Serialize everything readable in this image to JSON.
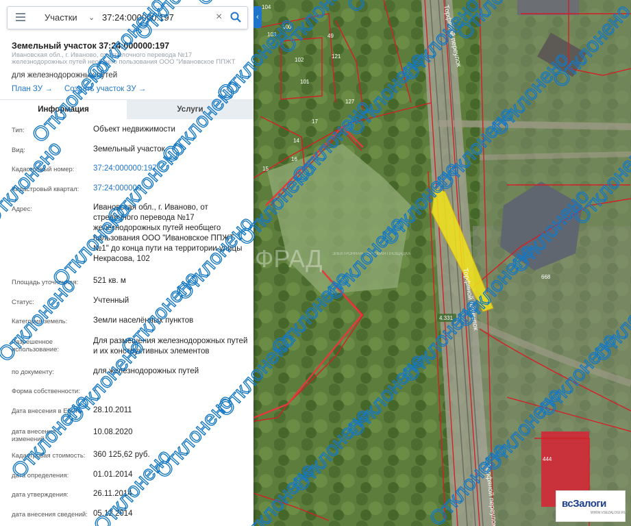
{
  "search": {
    "type_label": "Участки",
    "query": "37:24:000000:197"
  },
  "parcel": {
    "title": "Земельный участок 37:24:000000:197",
    "address_short": "Ивановская обл., г. Иваново, от стрелочного перевода №17 железнодорожных путей необщего пользования ООО \"Ивановское ППЖТ №1\" до конца пути н...",
    "use_short": "для железнодорожных путей",
    "link_plan": "План ЗУ →",
    "link_create": "Создать участок ЗУ →"
  },
  "tabs": [
    "Информация",
    "Услуги"
  ],
  "info_rows": [
    {
      "label": "Тип:",
      "value": "Объект недвижимости"
    },
    {
      "label": "Вид:",
      "value": "Земельный участок"
    },
    {
      "label": "Кадастровый номер:",
      "value": "37:24:000000:197"
    },
    {
      "label": "Кадастровый квартал:",
      "value": "37:24:000000"
    },
    {
      "label": "Адрес:",
      "value": "Ивановская обл., г. Иваново, от стрелочного перевода №17 железнодорожных путей необщего пользования ООО \"Ивановское ППЖТ №1\" до конца пути на территории улицы Некрасова, 102"
    },
    {
      "label": "Площадь уточненная:",
      "value": "521 кв. м"
    },
    {
      "label": "Статус:",
      "value": "Учтенный"
    },
    {
      "label": "Категория земель:",
      "value": "Земли населённых пунктов"
    },
    {
      "label": "Разрешенное использование:",
      "value": "Для размещения железнодорожных путей и их конструктивных элементов"
    },
    {
      "label": "по документу:",
      "value": "для железнодорожных путей"
    },
    {
      "label": "Форма собственности:",
      "value": "-"
    },
    {
      "label": "Дата внесения в ЕГРН:",
      "value": "28.10.2011"
    },
    {
      "label": "дата внесения изменений:",
      "value": "10.08.2020"
    },
    {
      "label": "Кадастровая стоимость:",
      "value": "360 125,62 руб."
    },
    {
      "label": "дата определения:",
      "value": "01.01.2014"
    },
    {
      "label": "дата утверждения:",
      "value": "26.11.2014"
    },
    {
      "label": "дата внесения сведений:",
      "value": "05.12.2014"
    }
  ],
  "map": {
    "street_1": "Торфяной переулок",
    "street_2": "Торфяной переулок",
    "street_3": "Торфяной переулок",
    "parcel_labels": [
      "104",
      "103",
      "102",
      "101",
      "127",
      "17",
      "14",
      "16",
      "15",
      "668",
      "444",
      "49",
      "100",
      "121"
    ],
    "marker": "4.331",
    "watermark_brand": "ФРАД",
    "watermark_sub": "ЭЛЕКТРОННАЯ ТОРГОВАЯ ПЛОЩАДКА"
  },
  "watermark": "Отклонено",
  "logo": {
    "text": "всЗалоги",
    "sub": "WWW.VSEZALOGI.RU"
  },
  "colors": {
    "accent": "#1f75c9",
    "watermark": "#1578c3",
    "parcel_border": "#d41f26",
    "selected_parcel": "#f2e31b"
  }
}
